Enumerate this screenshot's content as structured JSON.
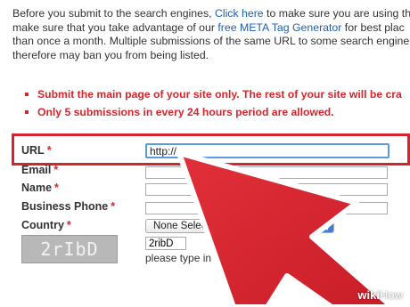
{
  "intro": {
    "line1_pre": "Before you submit to the search engines, ",
    "line1_link": "Click here",
    "line1_post": " to make sure you are using th",
    "line2_pre": "make sure that you take advantage of our ",
    "line2_link": "free META Tag Generator",
    "line2_post": " for best plac",
    "line3": "than once a month. Multiple submissions of the same URL to some search engine",
    "line4": "therefore may ban you from being listed."
  },
  "bullets": [
    "Submit the main page of your site only. The rest of your site will be cra",
    "Only 5 submissions in every 24 hours period are allowed."
  ],
  "form": {
    "required_marker": "*",
    "url": {
      "label": "URL",
      "value": "http://"
    },
    "email": {
      "label": "Email"
    },
    "name": {
      "label": "Name"
    },
    "phone": {
      "label": "Business Phone"
    },
    "country": {
      "label": "Country",
      "selected": "None Selec"
    },
    "captcha": {
      "image_text": "2rIbD",
      "input_value": "2ribD",
      "hint": "please type in the                   n in the image o"
    }
  },
  "colors": {
    "accent_red": "#d2262f",
    "link_blue": "#1e5fb3",
    "focus_blue": "#5a9be0"
  },
  "arrow_icon": "large-red-cursor-arrow-icon",
  "watermark": {
    "wiki": "wiki",
    "how": "How"
  }
}
